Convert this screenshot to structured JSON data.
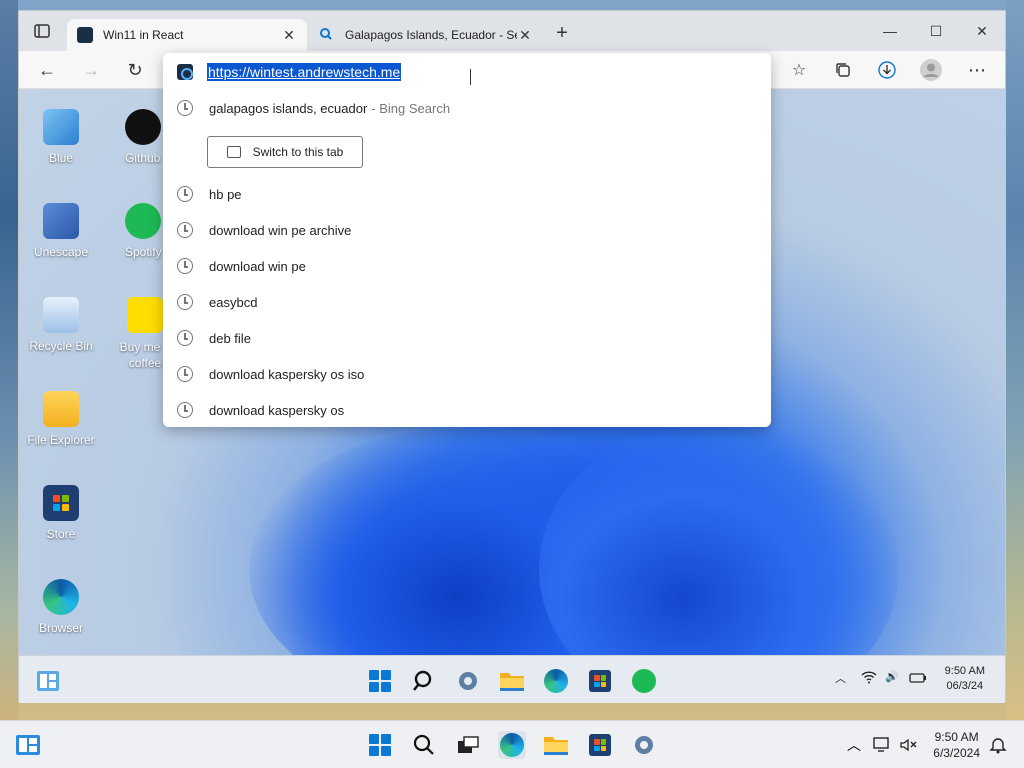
{
  "browser": {
    "tabs": [
      {
        "title": "Win11 in React",
        "active": true
      },
      {
        "title": "Galapagos Islands, Ecuador - Sea",
        "active": false
      }
    ]
  },
  "omnibox": {
    "url": "https://wintest.andrewstech.me",
    "top_suggestion": {
      "text": "galapagos islands, ecuador",
      "suffix": "- Bing Search"
    },
    "switch_tab_label": "Switch to this tab",
    "history": [
      "hb pe",
      "download win pe archive",
      "download win pe",
      "easybcd",
      "deb file",
      "download kaspersky os iso",
      "download kaspersky os"
    ]
  },
  "desktop": {
    "icons": [
      {
        "label": "Blue"
      },
      {
        "label": "Github"
      },
      {
        "label": "Unescape"
      },
      {
        "label": "Spotify"
      },
      {
        "label": "Recycle Bin"
      },
      {
        "label": "Buy me a coffee"
      },
      {
        "label": "File Explorer"
      },
      {
        "label": "Store"
      },
      {
        "label": "Browser"
      }
    ]
  },
  "inner_taskbar": {
    "time": "9:50 AM",
    "date": "06/3/24"
  },
  "outer_taskbar": {
    "time": "9:50 AM",
    "date": "6/3/2024"
  },
  "colors": {
    "accent": "#0b57d0",
    "win_blue": "#0a78d4",
    "spotify": "#1db954"
  }
}
